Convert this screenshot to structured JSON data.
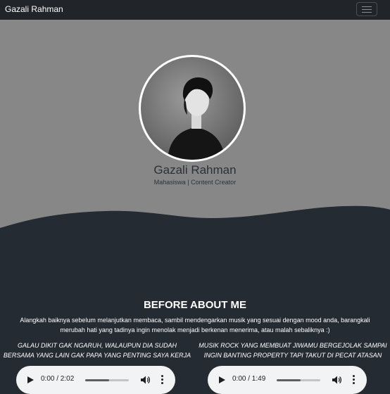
{
  "navbar": {
    "brand": "Gazali Rahman",
    "toggler_icon": "hamburger-icon"
  },
  "profile": {
    "name": "Gazali Rahman",
    "subtitle": "Mahasiswa | Content Creator"
  },
  "section": {
    "title": "BEFORE ABOUT ME",
    "intro": "Alangkah baiknya sebelum melanjutkan membaca, sambil mendengarkan musik yang sesuai dengan mood anda, barangkali merubah hati yang tadinya ingin menolak menjadi berkenan menerima, atau malah sebaliknya :)"
  },
  "tracks": [
    {
      "caption": "GALAU DIKIT GAK NGARUH, WALAUPUN DIA SUDAH BERSAMA YANG LAIN GAK PAPA YANG PENTING SAYA KERJA",
      "time": "0:00 / 2:02",
      "volume": 0.55
    },
    {
      "caption": "MUSIK ROCK YANG MEMBUAT JIWAMU BERGEJOLAK SAMPAI INGIN BANTING PROPERTY TAPI TAKUT DI PECAT ATASAN",
      "time": "0:00 / 1:49",
      "volume": 0.55
    }
  ],
  "colors": {
    "navbar": "#212529",
    "hero": "#878787",
    "dark": "#252b33",
    "player": "#f1f3f4"
  }
}
